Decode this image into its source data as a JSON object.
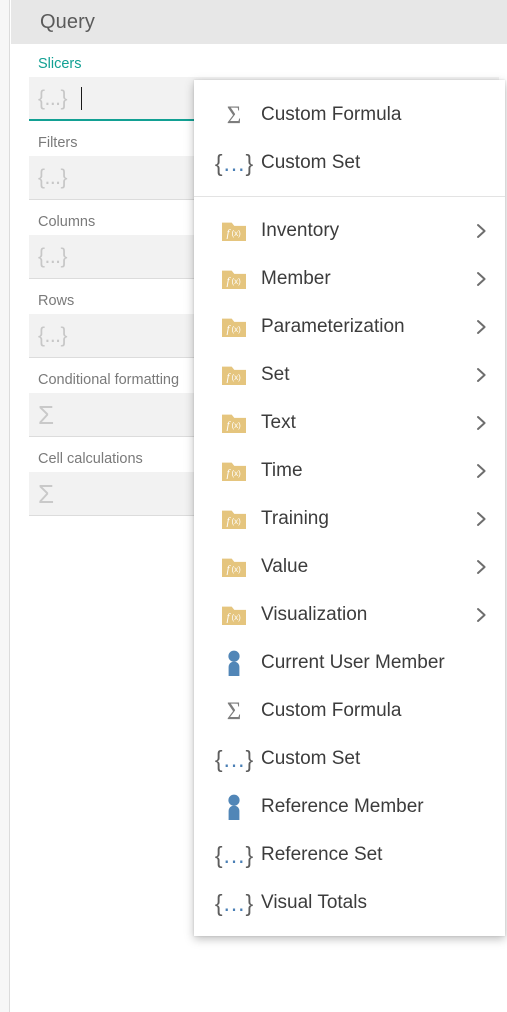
{
  "panel": {
    "title": "Query",
    "fields": [
      {
        "label": "Slicers",
        "placeholder_icon": "set-braces-icon",
        "placeholder_text": "{...}",
        "state": "focused",
        "label_active": true
      },
      {
        "label": "Filters",
        "placeholder_icon": "set-braces-icon",
        "placeholder_text": "{...}",
        "state": "normal",
        "label_active": false
      },
      {
        "label": "Columns",
        "placeholder_icon": "set-braces-icon",
        "placeholder_text": "{...}",
        "state": "normal",
        "label_active": false
      },
      {
        "label": "Rows",
        "placeholder_icon": "set-braces-icon",
        "placeholder_text": "{...}",
        "state": "normal",
        "label_active": false
      },
      {
        "label": "Conditional formatting",
        "placeholder_icon": "sigma-icon",
        "placeholder_text": "Σ",
        "state": "normal",
        "label_active": false
      },
      {
        "label": "Cell calculations",
        "placeholder_icon": "sigma-icon",
        "placeholder_text": "Σ",
        "state": "normal",
        "label_active": false
      }
    ]
  },
  "menu": {
    "groups": [
      {
        "items": [
          {
            "label": "Custom Formula",
            "icon": "sigma-icon",
            "submenu": false
          },
          {
            "label": "Custom Set",
            "icon": "set-braces-icon",
            "submenu": false
          }
        ]
      },
      {
        "items": [
          {
            "label": "Inventory",
            "icon": "fx-folder-icon",
            "submenu": true
          },
          {
            "label": "Member",
            "icon": "fx-folder-icon",
            "submenu": true
          },
          {
            "label": "Parameterization",
            "icon": "fx-folder-icon",
            "submenu": true
          },
          {
            "label": "Set",
            "icon": "fx-folder-icon",
            "submenu": true
          },
          {
            "label": "Text",
            "icon": "fx-folder-icon",
            "submenu": true
          },
          {
            "label": "Time",
            "icon": "fx-folder-icon",
            "submenu": true
          },
          {
            "label": "Training",
            "icon": "fx-folder-icon",
            "submenu": true
          },
          {
            "label": "Value",
            "icon": "fx-folder-icon",
            "submenu": true
          },
          {
            "label": "Visualization",
            "icon": "fx-folder-icon",
            "submenu": true
          },
          {
            "label": "Current User Member",
            "icon": "person-icon",
            "submenu": false
          },
          {
            "label": "Custom Formula",
            "icon": "sigma-icon",
            "submenu": false
          },
          {
            "label": "Custom Set",
            "icon": "set-braces-icon",
            "submenu": false
          },
          {
            "label": "Reference Member",
            "icon": "person-icon",
            "submenu": false
          },
          {
            "label": "Reference Set",
            "icon": "set-braces-icon",
            "submenu": false
          },
          {
            "label": "Visual Totals",
            "icon": "set-braces-icon",
            "submenu": false
          }
        ]
      }
    ]
  },
  "colors": {
    "accent_teal": "#12a093",
    "folder_tan": "#e5c57e",
    "person_blue": "#5186b7",
    "header_gray": "#e7e7e7",
    "field_gray": "#f2f2f2"
  }
}
